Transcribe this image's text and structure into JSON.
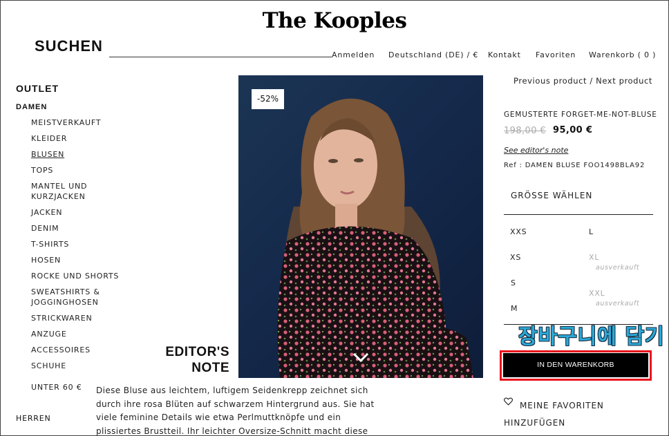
{
  "header": {
    "logo": "The Kooples",
    "search_label": "SUCHEN",
    "nav": [
      "Anmelden",
      "Deutschland (DE) / €",
      "Kontakt",
      "Favoriten",
      "Warenkorb ( 0 )"
    ]
  },
  "sidebar": {
    "outlet": "OUTLET",
    "damen": "DAMEN",
    "items": [
      "MEISTVERKAUFT",
      "KLEIDER",
      "BLUSEN",
      "TOPS",
      "MANTEL UND KURZJACKEN",
      "JACKEN",
      "DENIM",
      "T-SHIRTS",
      "HOSEN",
      "ROCKE UND SHORTS",
      "SWEATSHIRTS & JOGGINGHOSEN",
      "STRICKWAREN",
      "ANZUGE",
      "ACCESSOIRES",
      "SCHUHE"
    ],
    "active_item": "BLUSEN",
    "unter": "UNTER 60 €",
    "herren": "HERREN"
  },
  "product": {
    "discount_badge": "-52%",
    "nav_text": "Previous product / Next product",
    "name": "GEMUSTERTE FORGET-ME-NOT-BLUSE",
    "price_old": "198,00 €",
    "price_new": "95,00 €",
    "editor_link": "See editor's note",
    "ref": "Ref : DAMEN BLUSE FOO1498BLA92",
    "size_heading": "GRÖSSE WÄHLEN",
    "sizes": {
      "xxs": "XXS",
      "xs": "XS",
      "s": "S",
      "m": "M",
      "l": "L",
      "xl": "XL",
      "xxl": "XXL",
      "sold_out": "ausverkauft"
    },
    "cart_annotation": "장바구니에 담기",
    "cart_button": "IN DEN WARENKORB",
    "favorites": "MEINE FAVORITEN HINZUFÜGEN"
  },
  "editor": {
    "title": "EDITOR'S NOTE",
    "text": "Diese Bluse aus leichtem, luftigem Seidenkrepp zeichnet sich durch ihre rosa Blüten auf schwarzem Hintergrund aus. Sie hat viele feminine Details wie etwa Perlmuttknöpfe und ein plissiertes Brustteil. Ihr leichter Oversize-Schnitt macht diese Bluse zu einem"
  },
  "colors": {
    "accent_red": "#e8141c",
    "annotation_blue": "#2aa8d8",
    "photo_background": "#14284a"
  },
  "icons": [
    "heart-icon",
    "chevron-down-icon"
  ]
}
